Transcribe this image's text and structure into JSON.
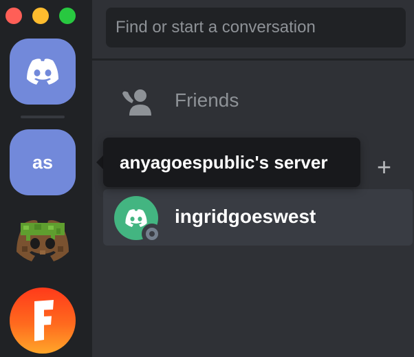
{
  "window": {
    "traffic_lights": [
      "close",
      "minimize",
      "zoom"
    ]
  },
  "servers": {
    "home": {
      "icon": "discord-logo-icon"
    },
    "anya": {
      "label": "as",
      "tooltip": "anyagoespublic's server"
    },
    "minecraft": {
      "icon": "minecraft-discord-icon"
    },
    "fortnite": {
      "icon": "fortnite-f-icon"
    }
  },
  "search": {
    "placeholder": "Find or start a conversation"
  },
  "nav": {
    "friends_label": "Friends"
  },
  "dm_section": {
    "add_icon": "plus-icon"
  },
  "direct_messages": [
    {
      "name": "ingridgoeswest",
      "status": "offline"
    }
  ],
  "colors": {
    "blurple": "#7289da",
    "green_avatar": "#43b581",
    "rail": "#202225",
    "main": "#2f3136",
    "tooltip_bg": "#18191c",
    "offline_grey": "#747f8d"
  }
}
